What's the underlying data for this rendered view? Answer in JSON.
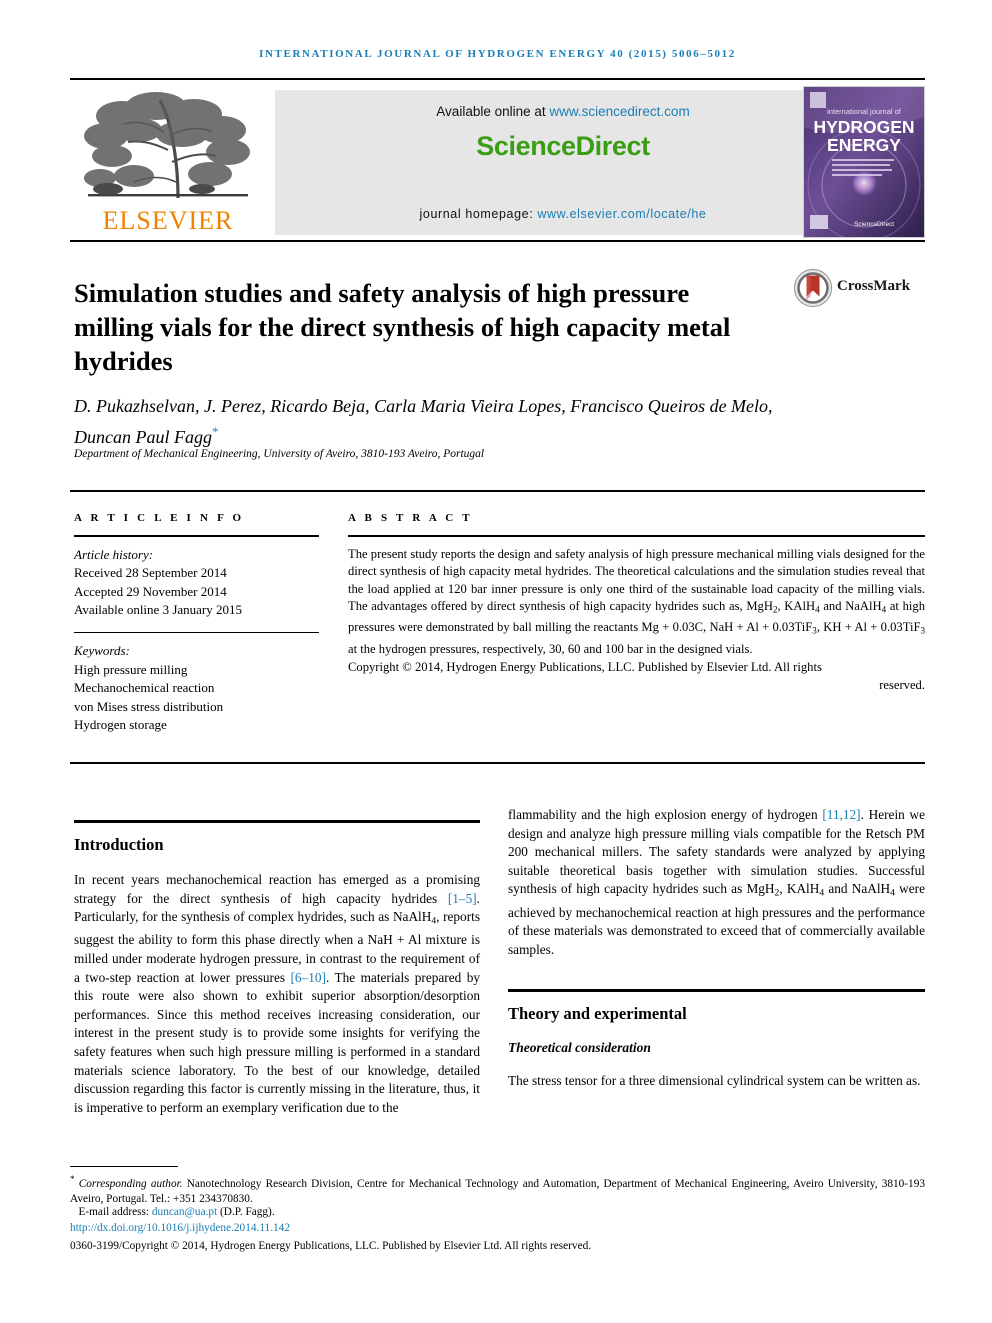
{
  "running_head": "International Journal of Hydrogen Energy 40 (2015) 5006–5012",
  "masthead": {
    "publisher_name": "ELSEVIER",
    "publisher_logo_alt": "elsevier-tree-logo",
    "available_prefix": "Available online at ",
    "available_url": "www.sciencedirect.com",
    "brand": "ScienceDirect",
    "homepage_label": "journal homepage: ",
    "homepage_url": "www.elsevier.com/locate/he",
    "cover": {
      "line_small": "international journal of",
      "line1": "HYDROGEN",
      "line2": "ENERGY",
      "footer_brand": "ScienceDirect"
    }
  },
  "article": {
    "title": "Simulation studies and safety analysis of high pressure milling vials for the direct synthesis of high capacity metal hydrides",
    "crossmark_label": "CrossMark",
    "authors": "D. Pukazhselvan, J. Perez, Ricardo Beja, Carla Maria Vieira Lopes, Francisco Queiros de Melo, Duncan Paul Fagg",
    "author_star": "*",
    "affiliation": "Department of Mechanical Engineering, University of Aveiro, 3810-193 Aveiro, Portugal"
  },
  "article_info": {
    "heading": "A R T I C L E   I N F O",
    "history_label": "Article history:",
    "history": [
      "Received 28 September 2014",
      "Accepted 29 November 2014",
      "Available online 3 January 2015"
    ],
    "keywords_label": "Keywords:",
    "keywords": [
      "High pressure milling",
      "Mechanochemical reaction",
      "von Mises stress distribution",
      "Hydrogen storage"
    ]
  },
  "abstract": {
    "heading": "A B S T R A C T",
    "body_part1": "The present study reports the design and safety analysis of high pressure mechanical milling vials designed for the direct synthesis of high capacity metal hydrides. The theoretical calculations and the simulation studies reveal that the load applied at 120 bar inner pressure is only one third of the sustainable load capacity of the milling vials. The advantages offered by direct synthesis of high capacity hydrides such as, MgH",
    "body_part2": ", KAlH",
    "body_part3": " and NaAlH",
    "body_part4": " at high pressures were demonstrated by ball milling the reactants Mg + 0.03C, NaH + Al + 0.03TiF",
    "body_part5": ", KH + Al + 0.03TiF",
    "body_part6": " at the hydrogen pressures, respectively, 30, 60 and 100 bar in the designed vials.",
    "copyright": "Copyright © 2014, Hydrogen Energy Publications, LLC. Published by Elsevier Ltd. All rights",
    "copyright_tail": "reserved."
  },
  "sections": {
    "introduction": {
      "heading": "Introduction",
      "p1_a": "In recent years mechanochemical reaction has emerged as a promising strategy for the direct synthesis of high capacity hydrides ",
      "p1_ref1": "[1–5]",
      "p1_b": ". Particularly, for the synthesis of complex hydrides, such as NaAlH",
      "p1_c": ", reports suggest the ability to form this phase directly when a NaH + Al mixture is milled under moderate hydrogen pressure, in contrast to the requirement of a two-step reaction at lower pressures ",
      "p1_ref2": "[6–10]",
      "p1_d": ". The materials prepared by this route were also shown to exhibit superior absorption/desorption performances. Since this method receives increasing consideration, our interest in the present study is to provide some insights for verifying the safety features when such high pressure milling is performed in a standard materials science laboratory. To the best of our knowledge, detailed discussion regarding this factor is currently missing in the literature, thus, it is imperative to perform an exemplary verification due to the"
    },
    "introduction_cont": {
      "p2_a": "flammability and the high explosion energy of hydrogen ",
      "p2_ref": "[11,12]",
      "p2_b": ". Herein we design and analyze high pressure milling vials compatible for the Retsch PM 200 mechanical millers. The safety standards were analyzed by applying suitable theoretical basis together with simulation studies. Successful synthesis of high capacity hydrides such as MgH",
      "p2_c": ", KAlH",
      "p2_d": " and NaAlH",
      "p2_e": " were achieved by mechanochemical reaction at high pressures and the performance of these materials was demonstrated to exceed that of commercially available samples."
    },
    "theory": {
      "heading": "Theory and experimental",
      "subheading": "Theoretical consideration",
      "p1": "The stress tensor for a three dimensional cylindrical system can be written as."
    }
  },
  "footnote": {
    "star": "*",
    "corresponding_italic": "Corresponding author.",
    "corresponding_rest": " Nanotechnology Research Division, Centre for Mechanical Technology and Automation, Department of Mechanical Engineering, Aveiro University, 3810-193 Aveiro, Portugal. Tel.: +351 234370830.",
    "email_label": "E-mail address: ",
    "email": "duncan@ua.pt",
    "email_suffix": " (D.P. Fagg).",
    "doi": "http://dx.doi.org/10.1016/j.ijhydene.2014.11.142",
    "issn_copyright": "0360-3199/Copyright © 2014, Hydrogen Energy Publications, LLC. Published by Elsevier Ltd. All rights reserved."
  },
  "colors": {
    "link": "#1a7eb5",
    "elsevier_orange": "#ef8200",
    "sciencedirect_green": "#3a9e14",
    "crossmark_red": "#b8352a",
    "sd_panel_bg": "#e6e6e6"
  },
  "subscripts": {
    "two": "2",
    "four": "4",
    "three": "3"
  }
}
